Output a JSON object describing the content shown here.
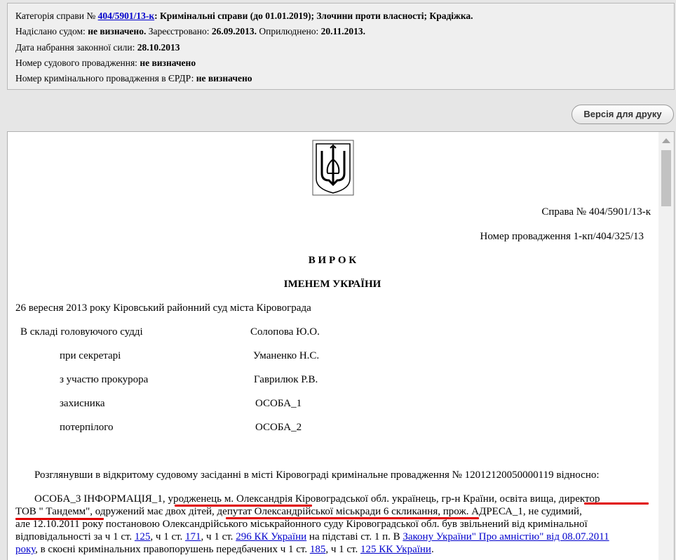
{
  "meta": {
    "line1": {
      "label": "Категорія справи № ",
      "case_link": "404/5901/13-к",
      "rest": ": Кримінальні справи (до 01.01.2019); Злочини проти власності; Крадіжка."
    },
    "line2": {
      "label_sent": "Надіслано судом: ",
      "sent": "не визначено.",
      "label_reg": " Зареєстровано: ",
      "reg": "26.09.2013.",
      "label_pub": " Оприлюднено: ",
      "pub": "20.11.2013."
    },
    "line3": {
      "label": "Дата набрання законної сили: ",
      "value": "28.10.2013"
    },
    "line4": {
      "label": "Номер судового провадження: ",
      "value": "не визначено"
    },
    "line5": {
      "label": "Номер кримінального провадження в ЄРДР: ",
      "value": "не визначено"
    }
  },
  "print_button": "Версія для друку",
  "doc": {
    "case_no": "Справа №  404/5901/13-к",
    "proceeding_no": "Номер провадження  1-кп/404/325/13",
    "title": "В И Р О К",
    "subtitle": "ІМЕНЕМ    УКРАЇНИ",
    "date_court": "26 вересня 2013 року   Кіровський районний суд міста Кіровограда",
    "composition": [
      {
        "role": "В складі головуючого судді",
        "name": "Солопова Ю.О."
      },
      {
        "role": "при секретарі",
        "name": "Уманенко Н.С."
      },
      {
        "role": "з участю прокурора",
        "name": "Гаврилюк Р.В."
      },
      {
        "role": "захисника",
        "name": "ОСОБА_1"
      },
      {
        "role": "потерпілого",
        "name": "ОСОБА_2"
      }
    ],
    "para1": "Розглянувши в відкритому судовому засіданні в місті Кіровограді кримінальне провадження № 12012120050000119 відносно:",
    "para2": {
      "l1_a": "ОСОБА_3 ІНФОРМАЦІЯ_1, ",
      "l1_b": "уродженець м. Олександрія",
      "l1_c": " Кіровоградської обл. українець, гр-н Країни, освіта вища, ",
      "l1_d": "директор",
      "l2_a": "ТОВ \" Тандемм\"",
      "l2_b": ", одружений має двох дітей, ",
      "l2_c": "депутат Олександрійської міськради 6 скликання",
      "l2_d": ", прож. АДРЕСА_1, не судимий,",
      "l3": "але  12.10.2011 року постановою Олександрійського  міськрайонного суду Кіровоградської обл. був звільнений від кримінальної",
      "l4_a": "відповідальності за  ч 1 ст. ",
      "l4_link1": "125",
      "l4_b": ", ч 1 ст. ",
      "l4_link2": "171",
      "l4_c": ", ч 1 ст. ",
      "l4_link3": "296 КК України",
      "l4_d": " на підставі ст. 1 п. В ",
      "l4_link4": "Закону України\" Про амністію\" від  08.07.2011",
      "l5_link1": "року",
      "l5_a": ", в скоєні кримінальних правопорушень передбачених ч 1 ст. ",
      "l5_link2": "185",
      "l5_b": ", ч 1 ст. ",
      "l5_link3": "125 КК України",
      "l5_c": "."
    }
  },
  "colors": {
    "link": "#0000cc",
    "annotation": "#e00000"
  }
}
